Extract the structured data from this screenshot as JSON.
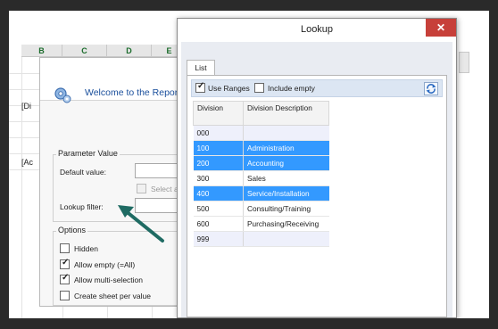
{
  "sheet": {
    "columns": [
      "B",
      "C",
      "D",
      "E"
    ],
    "row_labels": [
      "[Di",
      "[Ac"
    ]
  },
  "wizard": {
    "title": "Welcome to the Repor",
    "parameter_group": "Parameter Value",
    "default_label": "Default value:",
    "select_all_label": "Select all it",
    "lookup_filter_label": "Lookup filter:",
    "options_group": "Options",
    "options": [
      {
        "label": "Hidden",
        "checked": false
      },
      {
        "label": "Allow empty (=All)",
        "checked": true
      },
      {
        "label": "Allow multi-selection",
        "checked": true
      },
      {
        "label": "Create sheet per value",
        "checked": false
      }
    ]
  },
  "lookup": {
    "title": "Lookup",
    "close_glyph": "✕",
    "tab": "List",
    "use_ranges_label": "Use Ranges",
    "use_ranges_checked": true,
    "include_empty_label": "Include empty",
    "include_empty_checked": false,
    "columns": [
      "Division",
      "Division Description"
    ],
    "rows": [
      {
        "code": "000",
        "desc": "",
        "selected": false
      },
      {
        "code": "100",
        "desc": "Administration",
        "selected": true
      },
      {
        "code": "200",
        "desc": "Accounting",
        "selected": true
      },
      {
        "code": "300",
        "desc": "Sales",
        "selected": false
      },
      {
        "code": "400",
        "desc": "Service/Installation",
        "selected": true
      },
      {
        "code": "500",
        "desc": "Consulting/Training",
        "selected": false
      },
      {
        "code": "600",
        "desc": "Purchasing/Receiving",
        "selected": false
      },
      {
        "code": "999",
        "desc": "",
        "selected": false
      }
    ]
  },
  "colors": {
    "selection": "#3399ff",
    "close_button": "#c7403a",
    "arrow": "#1f6b63",
    "column_header_text": "#1a6b2b"
  }
}
